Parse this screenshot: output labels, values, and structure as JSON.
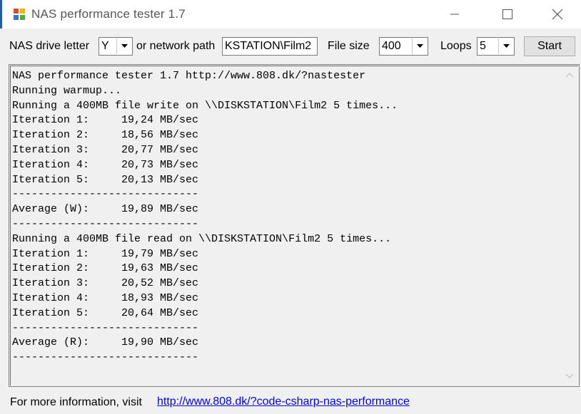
{
  "window": {
    "title": "NAS performance tester 1.7",
    "icon": "app-icon",
    "controls": [
      "minimize-icon",
      "maximize-icon",
      "close-icon"
    ]
  },
  "toolbar": {
    "drive_label": "NAS drive letter",
    "drive_value": "Y",
    "path_label": "or network path",
    "path_value": "KSTATION\\Film2",
    "filesize_label": "File size",
    "filesize_value": "400",
    "loops_label": "Loops",
    "loops_value": "5",
    "start_label": "Start"
  },
  "output": {
    "lines": [
      "NAS performance tester 1.7 http://www.808.dk/?nastester",
      "Running warmup...",
      "Running a 400MB file write on \\\\DISKSTATION\\Film2 5 times...",
      "Iteration 1:     19,24 MB/sec",
      "Iteration 2:     18,56 MB/sec",
      "Iteration 3:     20,77 MB/sec",
      "Iteration 4:     20,73 MB/sec",
      "Iteration 5:     20,13 MB/sec",
      "-----------------------------",
      "Average (W):     19,89 MB/sec",
      "-----------------------------",
      "Running a 400MB file read on \\\\DISKSTATION\\Film2 5 times...",
      "Iteration 1:     19,79 MB/sec",
      "Iteration 2:     19,63 MB/sec",
      "Iteration 3:     20,52 MB/sec",
      "Iteration 4:     18,93 MB/sec",
      "Iteration 5:     20,64 MB/sec",
      "-----------------------------",
      "Average (R):     19,90 MB/sec",
      "-----------------------------"
    ]
  },
  "footer": {
    "text": "For more information, visit",
    "link": "http://www.808.dk/?code-csharp-nas-performance"
  },
  "colors": {
    "accent": "#1e5fa8",
    "link": "#0000ee",
    "window_bg": "#f0f0f0"
  }
}
